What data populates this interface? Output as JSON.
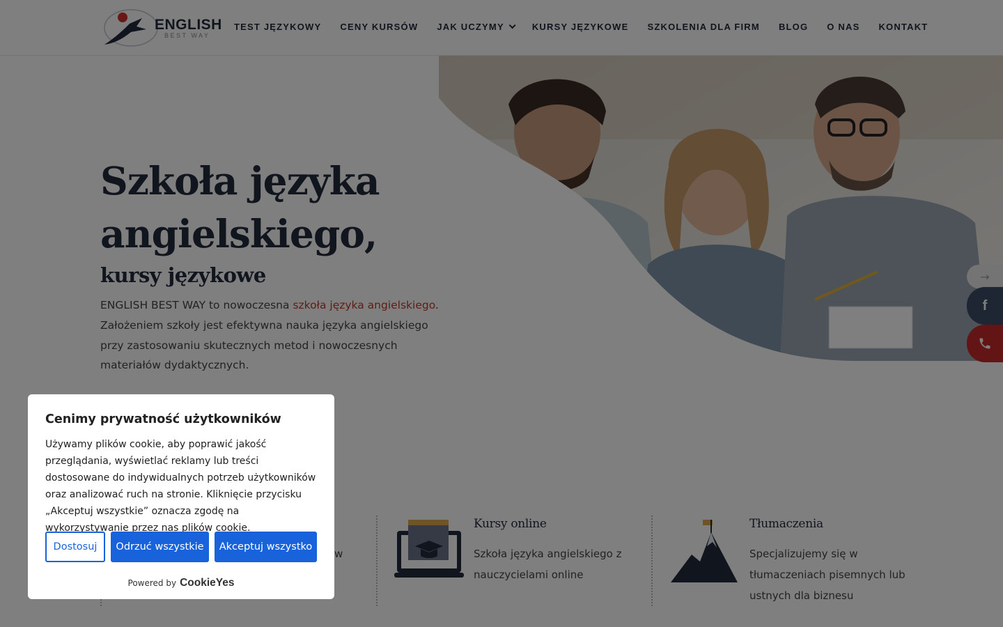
{
  "header": {
    "logo": {
      "title": "ENGLISH",
      "subtitle": "BEST WAY"
    },
    "nav": [
      {
        "label": "TEST JĘZYKOWY"
      },
      {
        "label": "CENY KURSÓW"
      },
      {
        "label": "JAK UCZYMY",
        "has_dropdown": true
      },
      {
        "label": "KURSY JĘZYKOWE"
      },
      {
        "label": "SZKOLENIA DLA FIRM"
      },
      {
        "label": "BLOG"
      },
      {
        "label": "O NAS"
      },
      {
        "label": "KONTAKT"
      }
    ]
  },
  "hero": {
    "title_line1": "Szkoła języka",
    "title_line2": "angielskiego,",
    "subtitle": "kursy językowe",
    "text_before": "ENGLISH BEST WAY to nowoczesna ",
    "text_link": "szkoła języka angielskiego",
    "text_after": ". Założeniem szkoły jest efektywna nauka języka angielskiego przy zastosowaniu skutecznych metod i nowoczesnych materiałów dydaktycznych.",
    "image_icon": "business-team-photo"
  },
  "features": {
    "partial_text": "w",
    "items": [
      {
        "title": "Kursy online",
        "text": "Szkoła języka angielskiego z nauczycielami online",
        "icon": "laptop-graduation-cap-icon"
      },
      {
        "title": "Tłumaczenia",
        "text": "Specjalizujemy się w tłumaczeniach pisemnych lub ustnych dla biznesu",
        "icon": "mountain-flag-icon"
      }
    ]
  },
  "floating": {
    "arrow": "→",
    "facebook": "f",
    "phone_icon": "phone-icon"
  },
  "cookie": {
    "title": "Cenimy prywatność użytkowników",
    "text": "Używamy plików cookie, aby poprawić jakość przeglądania, wyświetlać reklamy lub treści dostosowane do indywidualnych potrzeb użytkowników oraz analizować ruch na stronie. Kliknięcie przycisku „Akceptuj wszystkie” oznacza zgodę na wykorzystywanie przez nas plików cookie.",
    "customize_label": "Dostosuj",
    "reject_label": "Odrzuć wszystkie",
    "accept_label": "Akceptuj wszystko",
    "powered_label": "Powered by",
    "powered_brand": "CookieYes"
  },
  "colors": {
    "navy": "#232a3a",
    "link_red": "#c0392b",
    "cookie_blue": "#1863dc",
    "phone_red": "#c62828",
    "fb_blue": "#3c4c66"
  }
}
